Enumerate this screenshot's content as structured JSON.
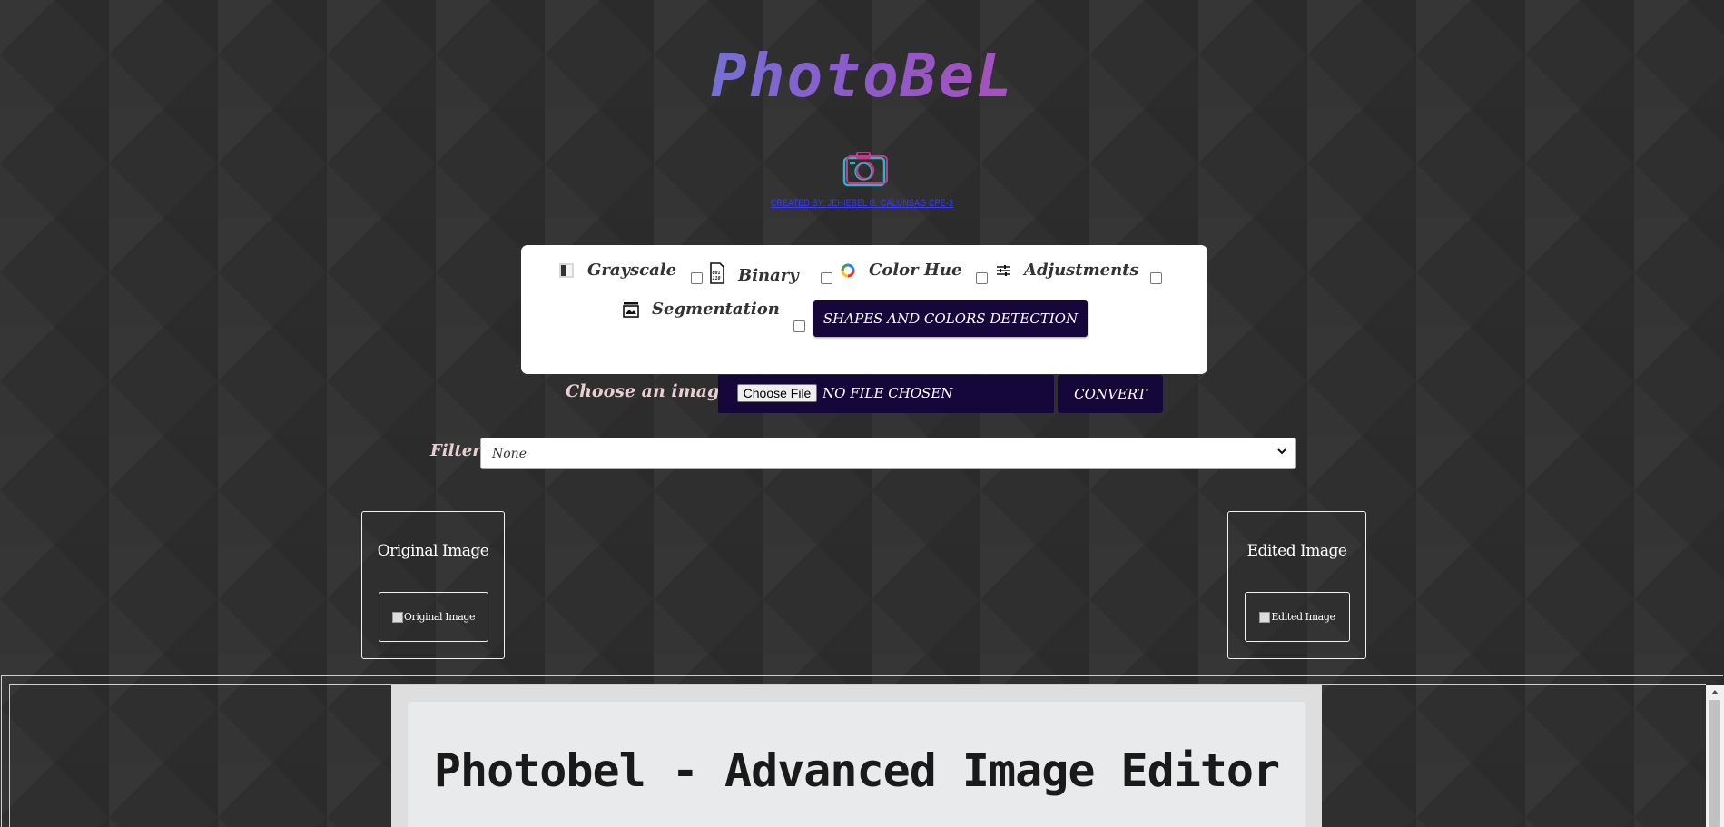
{
  "header": {
    "logo_text": "PhotoBeL",
    "credit": "CREATED BY: JEHIEBEL G. CALUNSAG CPE-3"
  },
  "options": [
    {
      "label": "Grayscale",
      "icon": "grayscale-icon"
    },
    {
      "label": "Binary",
      "icon": "binary-icon"
    },
    {
      "label": "Color Hue",
      "icon": "color-wheel-icon"
    },
    {
      "label": "Adjustments",
      "icon": "sliders-icon"
    },
    {
      "label": "Segmentation",
      "icon": "segmentation-icon"
    }
  ],
  "shapes_button": "SHAPES AND COLORS DETECTION",
  "upload": {
    "label": "Choose an image",
    "file_button": "Choose File",
    "file_status": "NO FILE CHOSEN",
    "convert_button": "CONVERT"
  },
  "filter": {
    "label": "Filter",
    "selected": "None"
  },
  "original": {
    "title": "Original Image",
    "alt": "Original Image"
  },
  "edited": {
    "title": "Edited Image",
    "alt": "Edited Image"
  },
  "embedded_doc": {
    "title": "Photobel - Advanced Image Editor"
  },
  "colors": {
    "accent_dark": "#15073a",
    "logo_gradient_start": "#6f76d6",
    "logo_gradient_end": "#b04fb8",
    "label_pink": "#e8cfd2",
    "background": "#2f2f2f"
  }
}
